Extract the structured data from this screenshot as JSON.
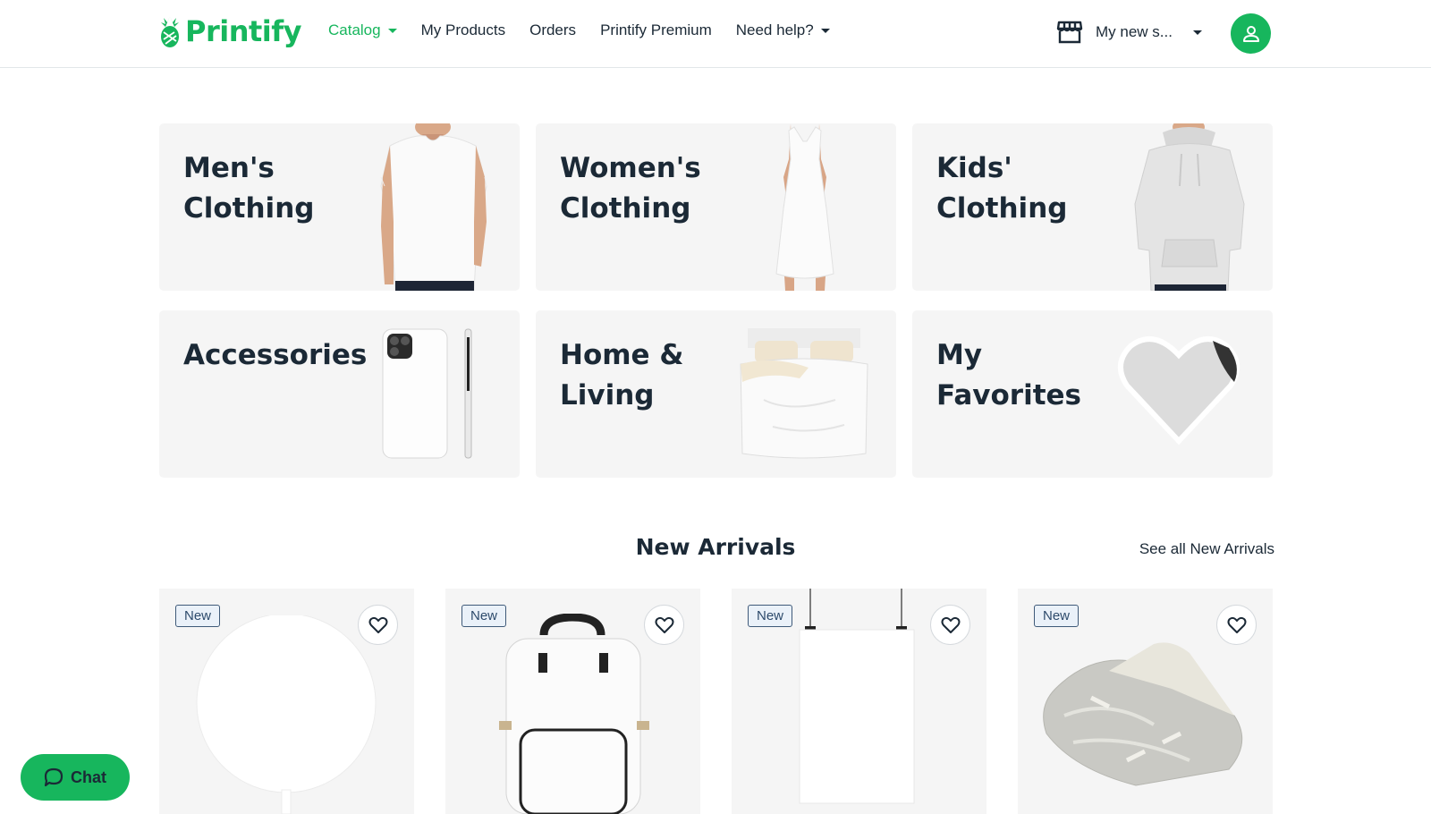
{
  "brand": {
    "name": "Printify",
    "color": "#17b65d"
  },
  "nav": {
    "items": [
      {
        "label": "Catalog",
        "active": true,
        "dropdown": true
      },
      {
        "label": "My Products",
        "active": false,
        "dropdown": false
      },
      {
        "label": "Orders",
        "active": false,
        "dropdown": false
      },
      {
        "label": "Printify Premium",
        "active": false,
        "dropdown": false
      },
      {
        "label": "Need help?",
        "active": false,
        "dropdown": true
      }
    ]
  },
  "store": {
    "label": "My new s...",
    "icon": "store-icon"
  },
  "user": {
    "icon": "user-icon"
  },
  "categories": [
    {
      "title": "Men's Clothing",
      "image": "white-tshirt"
    },
    {
      "title": "Women's Clothing",
      "image": "white-dress"
    },
    {
      "title": "Kids' Clothing",
      "image": "grey-hoodie"
    },
    {
      "title": "Accessories",
      "image": "phone-case"
    },
    {
      "title": "Home & Living",
      "image": "duvet-bed"
    },
    {
      "title": "My Favorites",
      "image": "heart-sticker"
    }
  ],
  "new_arrivals": {
    "title": "New Arrivals",
    "see_all": "See all New Arrivals",
    "products": [
      {
        "badge": "New",
        "image": "round-balloon"
      },
      {
        "badge": "New",
        "image": "white-backpack"
      },
      {
        "badge": "New",
        "image": "hanging-poster"
      },
      {
        "badge": "New",
        "image": "velvet-blanket"
      }
    ]
  },
  "chat": {
    "label": "Chat",
    "icon": "chat-icon"
  }
}
